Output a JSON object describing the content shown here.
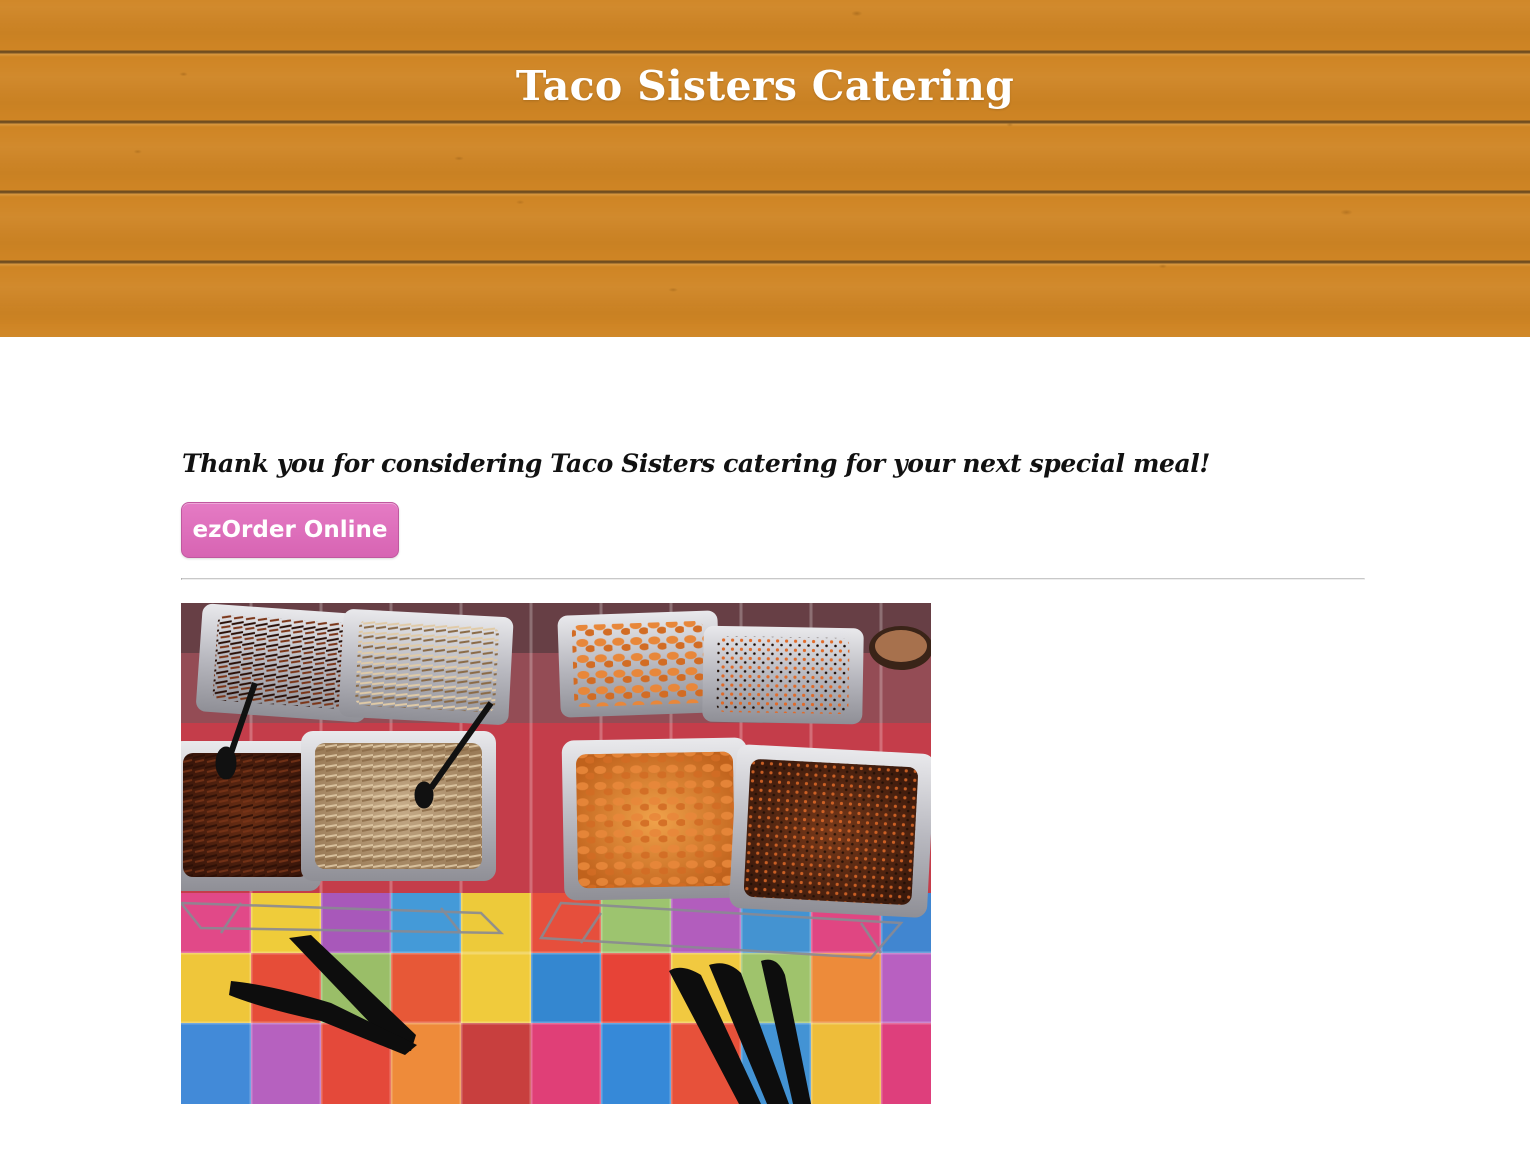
{
  "header": {
    "site_title": "Taco Sisters Catering",
    "background": "wood-planks",
    "accent_color": "#cf8524"
  },
  "main": {
    "intro_text": "Thank you for considering Taco Sisters catering for your next special meal!",
    "order_button": {
      "label": "ezOrder Online",
      "color": "#dc6cb9"
    },
    "photo": {
      "subject": "catering-buffet-trays-on-checkered-tablecloth"
    }
  }
}
